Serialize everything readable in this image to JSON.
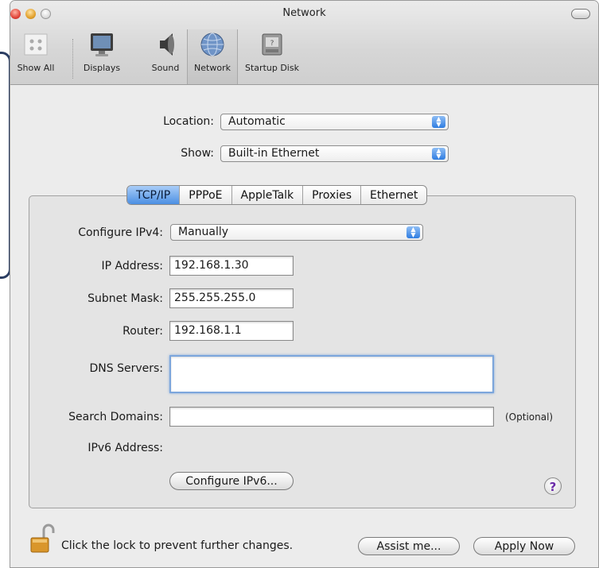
{
  "window": {
    "title": "Network"
  },
  "toolbar": {
    "items": [
      {
        "label": "Show All",
        "icon": "apple-icon"
      },
      {
        "label": "Displays",
        "icon": "display-icon"
      },
      {
        "label": "Sound",
        "icon": "speaker-icon"
      },
      {
        "label": "Network",
        "icon": "globe-icon",
        "selected": true
      },
      {
        "label": "Startup Disk",
        "icon": "disk-icon"
      }
    ]
  },
  "location": {
    "label": "Location:",
    "value": "Automatic"
  },
  "show": {
    "label": "Show:",
    "value": "Built-in Ethernet"
  },
  "tabs": [
    "TCP/IP",
    "PPPoE",
    "AppleTalk",
    "Proxies",
    "Ethernet"
  ],
  "active_tab": "TCP/IP",
  "tcpip": {
    "configure_label": "Configure IPv4:",
    "configure_value": "Manually",
    "ip_label": "IP Address:",
    "ip_value": "192.168.1.30",
    "subnet_label": "Subnet Mask:",
    "subnet_value": "255.255.255.0",
    "router_label": "Router:",
    "router_value": "192.168.1.1",
    "dns_label": "DNS Servers:",
    "dns_value": "",
    "search_label": "Search Domains:",
    "search_value": "",
    "search_hint": "(Optional)",
    "ipv6_label": "IPv6 Address:",
    "configure_ipv6_button": "Configure IPv6...",
    "help": "?"
  },
  "footer": {
    "lock_text": "Click the lock to prevent further changes.",
    "assist_button": "Assist me...",
    "apply_button": "Apply Now"
  },
  "colors": {
    "accent": "#4c8fe3",
    "callout_border": "#2b3d62",
    "callout_pointer": "#9ab6c9"
  }
}
